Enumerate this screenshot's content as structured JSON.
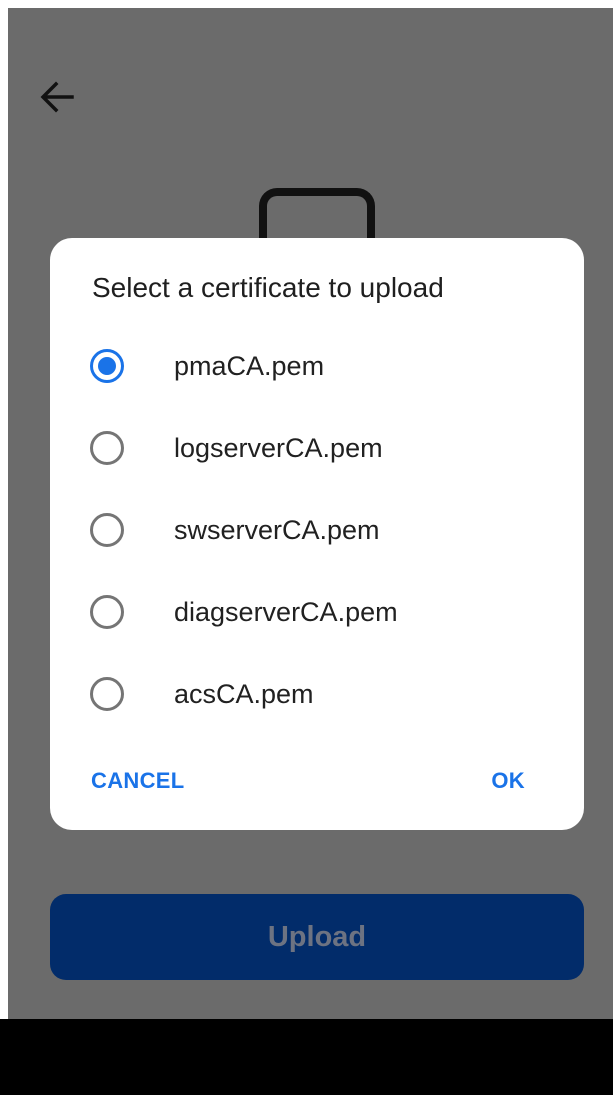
{
  "colors": {
    "scrim": "#6b6b6b",
    "accent": "#1a73e8",
    "upload_button_bg": "#022c6a",
    "upload_button_text": "#6d7382"
  },
  "icons": {
    "back": "back-arrow-icon",
    "device": "device-icon"
  },
  "main": {
    "upload_label": "Upload"
  },
  "dialog": {
    "title": "Select a certificate to upload",
    "options": [
      {
        "label": "pmaCA.pem",
        "checked": true
      },
      {
        "label": "logserverCA.pem",
        "checked": false
      },
      {
        "label": "swserverCA.pem",
        "checked": false
      },
      {
        "label": "diagserverCA.pem",
        "checked": false
      },
      {
        "label": "acsCA.pem",
        "checked": false
      }
    ],
    "cancel_label": "CANCEL",
    "ok_label": "OK"
  }
}
